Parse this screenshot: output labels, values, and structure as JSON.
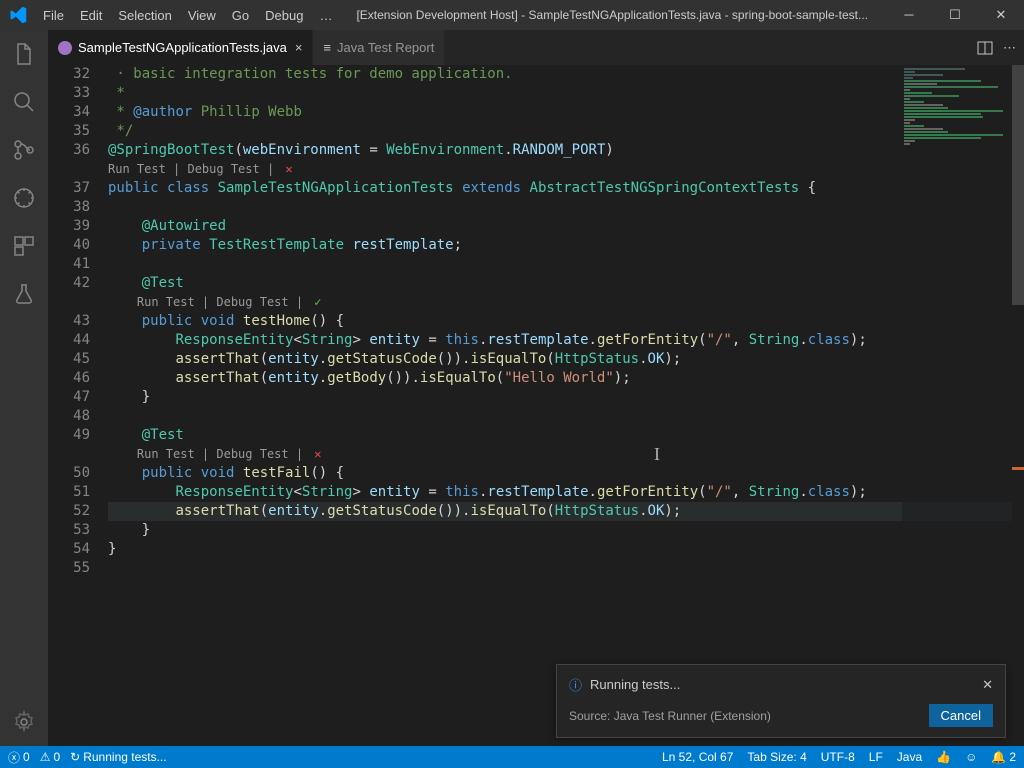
{
  "menus": [
    "File",
    "Edit",
    "Selection",
    "View",
    "Go",
    "Debug",
    "…"
  ],
  "window_title": "[Extension Development Host] - SampleTestNGApplicationTests.java - spring-boot-sample-test...",
  "tabs": [
    {
      "label": "SampleTestNGApplicationTests.java",
      "active": true
    },
    {
      "label": "Java Test Report",
      "active": false
    }
  ],
  "codelens": {
    "run": "Run Test",
    "debug": "Debug Test",
    "sep": "|"
  },
  "lines": {
    "start": 32,
    "content": [
      {
        "n": 32,
        "html": "<span class='cmt'> · basic integration tests for demo application.</span>"
      },
      {
        "n": 33,
        "html": "<span class='cmt'> *</span>"
      },
      {
        "n": 34,
        "html": "<span class='cmt'> * </span><span class='kw'>@author</span><span class='cmt'> Phillip Webb</span>"
      },
      {
        "n": 35,
        "html": "<span class='cmt'> */</span>"
      },
      {
        "n": 36,
        "html": "<span class='ann'>@SpringBootTest</span><span class='pun'>(</span><span class='var'>webEnvironment</span> <span class='pun'>=</span> <span class='type'>WebEnvironment</span><span class='pun'>.</span><span class='var'>RANDOM_PORT</span><span class='pun'>)</span>"
      },
      {
        "codelens": true,
        "status": "fail"
      },
      {
        "n": 37,
        "html": "<span class='kw'>public</span> <span class='kw'>class</span> <span class='type'>SampleTestNGApplicationTests</span> <span class='kw'>extends</span> <span class='type'>AbstractTestNGSpringContextTests</span> <span class='pun'>{</span>"
      },
      {
        "n": 38,
        "html": ""
      },
      {
        "n": 39,
        "html": "    <span class='ann'>@Autowired</span>"
      },
      {
        "n": 40,
        "html": "    <span class='kw'>private</span> <span class='type'>TestRestTemplate</span> <span class='var'>restTemplate</span><span class='pun'>;</span>"
      },
      {
        "n": 41,
        "html": ""
      },
      {
        "n": 42,
        "html": "    <span class='ann'>@Test</span>"
      },
      {
        "codelens": true,
        "status": "pass",
        "indent": "    "
      },
      {
        "n": 43,
        "html": "    <span class='kw'>public</span> <span class='kw'>void</span> <span class='fn'>testHome</span><span class='pun'>() {</span>"
      },
      {
        "n": 44,
        "html": "        <span class='type'>ResponseEntity</span><span class='pun'>&lt;</span><span class='type'>String</span><span class='pun'>&gt;</span> <span class='var'>entity</span> <span class='pun'>=</span> <span class='const'>this</span><span class='pun'>.</span><span class='var'>restTemplate</span><span class='pun'>.</span><span class='fn'>getForEntity</span><span class='pun'>(</span><span class='str'>\"/\"</span><span class='pun'>,</span> <span class='type'>String</span><span class='pun'>.</span><span class='const'>class</span><span class='pun'>);</span>"
      },
      {
        "n": 45,
        "html": "        <span class='fn'>assertThat</span><span class='pun'>(</span><span class='var'>entity</span><span class='pun'>.</span><span class='fn'>getStatusCode</span><span class='pun'>()).</span><span class='fn'>isEqualTo</span><span class='pun'>(</span><span class='type'>HttpStatus</span><span class='pun'>.</span><span class='var'>OK</span><span class='pun'>);</span>"
      },
      {
        "n": 46,
        "html": "        <span class='fn'>assertThat</span><span class='pun'>(</span><span class='var'>entity</span><span class='pun'>.</span><span class='fn'>getBody</span><span class='pun'>()).</span><span class='fn'>isEqualTo</span><span class='pun'>(</span><span class='str'>\"Hello World\"</span><span class='pun'>);</span>"
      },
      {
        "n": 47,
        "html": "    <span class='pun'>}</span>"
      },
      {
        "n": 48,
        "html": ""
      },
      {
        "n": 49,
        "html": "    <span class='ann'>@Test</span>"
      },
      {
        "codelens": true,
        "status": "fail",
        "indent": "    "
      },
      {
        "n": 50,
        "html": "    <span class='kw'>public</span> <span class='kw'>void</span> <span class='fn'>testFail</span><span class='pun'>() {</span>"
      },
      {
        "n": 51,
        "html": "        <span class='type'>ResponseEntity</span><span class='pun'>&lt;</span><span class='type'>String</span><span class='pun'>&gt;</span> <span class='var'>entity</span> <span class='pun'>=</span> <span class='const'>this</span><span class='pun'>.</span><span class='var'>restTemplate</span><span class='pun'>.</span><span class='fn'>getForEntity</span><span class='pun'>(</span><span class='str'>\"/\"</span><span class='pun'>,</span> <span class='type'>String</span><span class='pun'>.</span><span class='const'>class</span><span class='pun'>);</span>"
      },
      {
        "n": 52,
        "hl": true,
        "html": "        <span class='fn'>assertThat</span><span class='pun'>(</span><span class='var'>entity</span><span class='pun'>.</span><span class='fn'>getStatusCode</span><span class='pun'>()).</span><span class='fn'>isEqualTo</span><span class='pun'>(</span><span class='type'>HttpStatus</span><span class='pun'>.</span><span class='var'>OK</span><span class='pun'>);</span>"
      },
      {
        "n": 53,
        "html": "    <span class='pun'>}</span>"
      },
      {
        "n": 54,
        "html": "<span class='pun'>}</span>"
      },
      {
        "n": 55,
        "html": ""
      }
    ]
  },
  "notification": {
    "title": "Running tests...",
    "source": "Source: Java Test Runner (Extension)",
    "cancel": "Cancel"
  },
  "status": {
    "errors": "0",
    "warnings": "0",
    "running": "Running tests...",
    "pos": "Ln 52, Col 67",
    "tab": "Tab Size: 4",
    "enc": "UTF-8",
    "eol": "LF",
    "lang": "Java",
    "bell": "2"
  }
}
